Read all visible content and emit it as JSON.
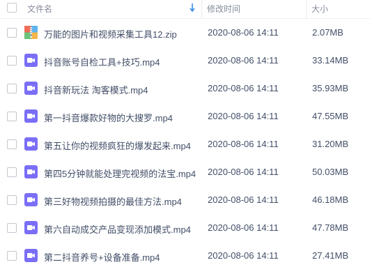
{
  "header": {
    "name_label": "文件名",
    "time_label": "修改时间",
    "size_label": "大小"
  },
  "colors": {
    "video_icon": "#7b6ef6",
    "zip_icon_bg": "#f2b64a",
    "sort_arrow": "#3a8ee6"
  },
  "files": [
    {
      "name": "万能的图片和视频采集工具12.zip",
      "time": "2020-08-06 14:11",
      "size": "2.07MB",
      "icon": "zip-icon"
    },
    {
      "name": "抖音账号自检工具+技巧.mp4",
      "time": "2020-08-06 14:11",
      "size": "33.14MB",
      "icon": "video-icon"
    },
    {
      "name": "抖音新玩法 淘客模式.mp4",
      "time": "2020-08-06 14:11",
      "size": "35.93MB",
      "icon": "video-icon"
    },
    {
      "name": "第一抖音爆款好物的大搜罗.mp4",
      "time": "2020-08-06 14:11",
      "size": "47.55MB",
      "icon": "video-icon"
    },
    {
      "name": "第五让你的视频疯狂的爆发起来.mp4",
      "time": "2020-08-06 14:11",
      "size": "31.20MB",
      "icon": "video-icon"
    },
    {
      "name": "第四5分钟就能处理完视频的法宝.mp4",
      "time": "2020-08-06 14:11",
      "size": "50.03MB",
      "icon": "video-icon"
    },
    {
      "name": "第三好物视频拍摄的最佳方法.mp4",
      "time": "2020-08-06 14:11",
      "size": "46.18MB",
      "icon": "video-icon"
    },
    {
      "name": "第六自动成交产品变现添加模式.mp4",
      "time": "2020-08-06 14:11",
      "size": "47.78MB",
      "icon": "video-icon"
    },
    {
      "name": "第二抖音养号+设备准备.mp4",
      "time": "2020-08-06 14:11",
      "size": "27.41MB",
      "icon": "video-icon"
    }
  ]
}
